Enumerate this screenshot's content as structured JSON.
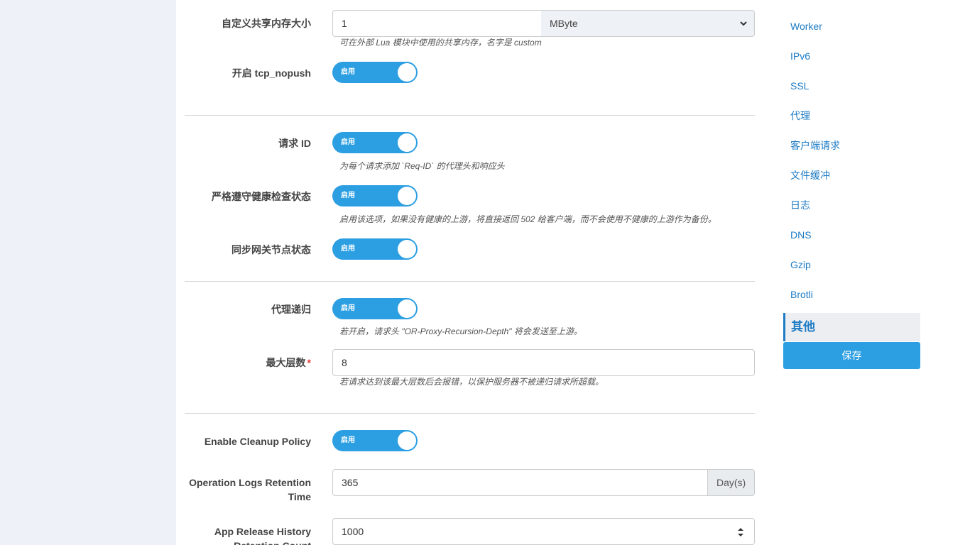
{
  "form": {
    "shared_mem": {
      "label": "自定义共享内存大小",
      "value": "1",
      "unit": "MByte",
      "help": "可在外部 Lua 模块中使用的共享内存，名字是 custom"
    },
    "tcp_nopush": {
      "label": "开启 tcp_nopush",
      "state": "启用"
    },
    "request_id": {
      "label": "请求 ID",
      "state": "启用",
      "help": "为每个请求添加 `Req-ID` 的代理头和响应头"
    },
    "strict_health": {
      "label": "严格遵守健康检查状态",
      "state": "启用",
      "help": "启用该选项，如果没有健康的上游，将直接返回 502 给客户端，而不会使用不健康的上游作为备份。"
    },
    "sync_gateway": {
      "label": "同步网关节点状态",
      "state": "启用"
    },
    "proxy_recursion": {
      "label": "代理递归",
      "state": "启用",
      "help": "若开启，请求头 \"OR-Proxy-Recursion-Depth\" 将会发送至上游。"
    },
    "max_depth": {
      "label": "最大层数",
      "required_mark": "*",
      "value": "8",
      "help": "若请求达到该最大层数后会报错，以保护服务器不被递归请求所超载。"
    },
    "cleanup_policy": {
      "label": "Enable Cleanup Policy",
      "state": "启用"
    },
    "op_logs_retention": {
      "label_line1": "Operation Logs Retention",
      "label_line2": "Time",
      "value": "365",
      "unit": "Day(s)"
    },
    "app_release_history": {
      "label_line1": "App Release History",
      "label_line2": "Retention Count",
      "value": "1000"
    }
  },
  "sidebar": {
    "items": [
      {
        "label": "Worker"
      },
      {
        "label": "IPv6"
      },
      {
        "label": "SSL"
      },
      {
        "label": "代理"
      },
      {
        "label": "客户端请求"
      },
      {
        "label": "文件缓冲"
      },
      {
        "label": "日志"
      },
      {
        "label": "DNS"
      },
      {
        "label": "Gzip"
      },
      {
        "label": "Brotli"
      }
    ],
    "active": "其他",
    "save_label": "保存"
  },
  "colors": {
    "accent": "#2c9fe3",
    "link": "#1e7bc4",
    "required": "#e53935"
  }
}
